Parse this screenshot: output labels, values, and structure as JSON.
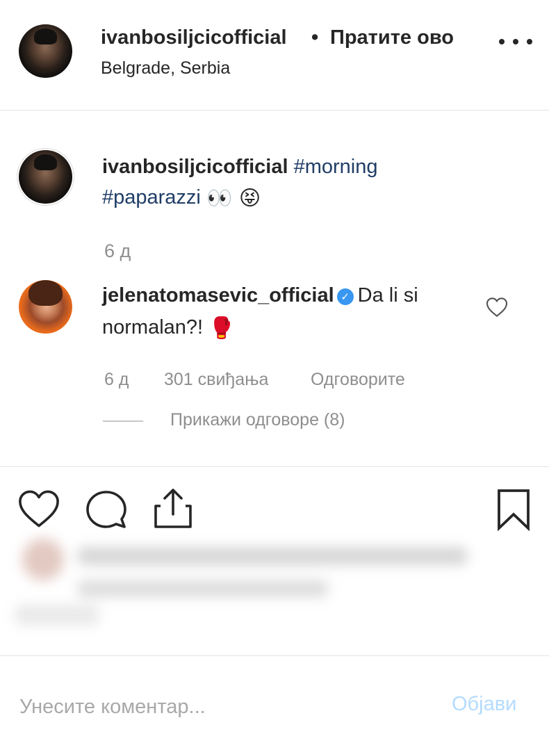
{
  "header": {
    "username": "ivanbosiljcicofficial",
    "separator": "•",
    "follow_label": "Пратите ово",
    "location": "Belgrade, Serbia"
  },
  "caption": {
    "username": "ivanbosiljcicofficial",
    "hashtag1": "#morning",
    "hashtag2": "#paparazzi",
    "emoji": "👀 😝",
    "time": "6 д"
  },
  "comment": {
    "username": "jelenatomasevic_official",
    "verified_mark": "✓",
    "text_line1": "Da li si",
    "text_line2": "normalan?!",
    "emoji": "🥊",
    "time": "6 д",
    "likes": "301 свиђања",
    "reply_label": "Одговорите",
    "view_replies": "Прикажи одговоре (8)"
  },
  "actions": {
    "icons": [
      "heart-icon",
      "comment-icon",
      "share-icon",
      "bookmark-icon"
    ]
  },
  "add_comment": {
    "placeholder": "Унесите коментар...",
    "post_label": "Објави"
  },
  "colors": {
    "text": "#262626",
    "muted": "#8e8e8e",
    "hashtag": "#1f3d66",
    "verified": "#3897f0",
    "post_disabled": "#b3dbff",
    "divider": "#e4e4e4"
  }
}
